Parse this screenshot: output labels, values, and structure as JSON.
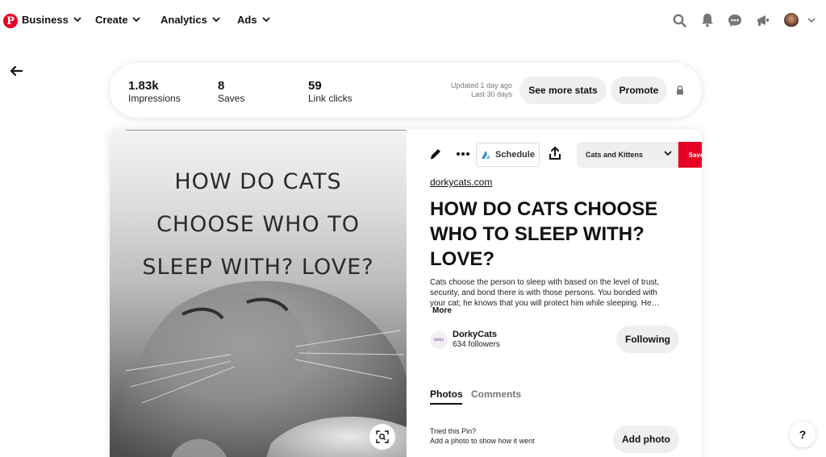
{
  "nav": {
    "logo_letter": "P",
    "items": [
      {
        "label": "Business"
      },
      {
        "label": "Create"
      },
      {
        "label": "Analytics"
      },
      {
        "label": "Ads"
      }
    ],
    "right_icons": [
      "search-icon",
      "notifications-icon",
      "messages-icon",
      "announcements-icon",
      "avatar",
      "chevron-down-icon"
    ]
  },
  "stats": {
    "items": [
      {
        "value": "1.83k",
        "label": "Impressions"
      },
      {
        "value": "8",
        "label": "Saves"
      },
      {
        "value": "59",
        "label": "Link clicks"
      }
    ],
    "updated_line1": "Updated 1 day ago",
    "updated_line2": "Last 30 days",
    "see_more_label": "See more stats",
    "promote_label": "Promote"
  },
  "pin": {
    "image_text": [
      "HOW DO CATS",
      "CHOOSE WHO TO",
      "SLEEP WITH? LOVE?"
    ],
    "schedule_label": "Schedule",
    "board_name": "Cats and Kittens",
    "save_label": "Save",
    "domain": "dorkycats.com",
    "title": "HOW DO CATS CHOOSE WHO TO SLEEP WITH? LOVE?",
    "description": "Cats choose the person to sleep with based on the level of trust, security, and bond there is with those persons. You bonded with your cat; he knows that you will protect him while sleeping. He…",
    "more_label": "More",
    "creator": {
      "avatar_text": "dorky",
      "name": "DorkyCats",
      "followers": "634 followers",
      "following_label": "Following"
    },
    "tabs": [
      {
        "label": "Photos",
        "active": true
      },
      {
        "label": "Comments",
        "active": false
      }
    ],
    "tried_title": "Tried this Pin?",
    "tried_subtitle": "Add a photo to show how it went",
    "add_photo_label": "Add photo"
  },
  "help_label": "?",
  "colors": {
    "brand_red": "#e60023",
    "pill_gray": "#efefef",
    "schedule_icon_blue": "#3b8ee0"
  }
}
